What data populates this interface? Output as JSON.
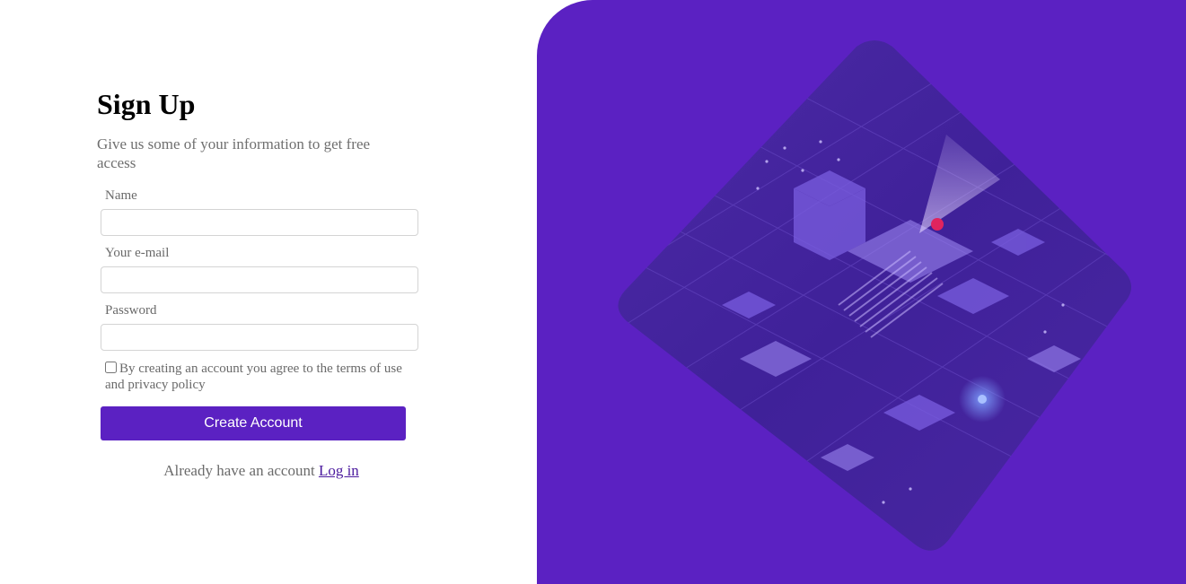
{
  "signup": {
    "title": "Sign Up",
    "subtitle": "Give us some of your information to get free access",
    "fields": {
      "name_label": "Name",
      "email_label": "Your e-mail",
      "password_label": "Password"
    },
    "terms_text": "By creating an account you agree to the terms of use and privacy policy",
    "create_button": "Create Account",
    "login_prompt": "Already have an account",
    "login_link": "Log in"
  },
  "colors": {
    "accent": "#5b21c2",
    "panel_dark": "#3d1b8e",
    "muted_text": "#6a6a6a"
  },
  "illustration": {
    "icon": "circuit-city-illustration"
  }
}
